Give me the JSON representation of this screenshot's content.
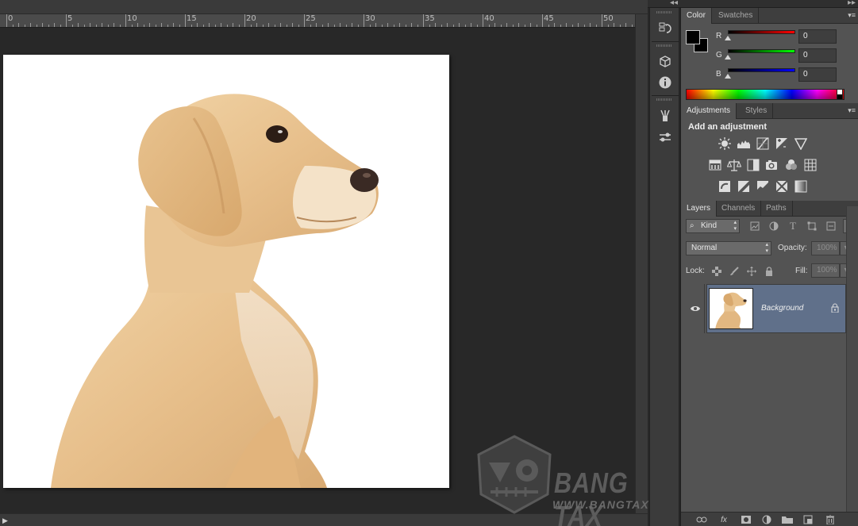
{
  "ruler": {
    "labels": [
      "0",
      "5",
      "10",
      "15",
      "20",
      "25",
      "30",
      "35",
      "40",
      "45",
      "50"
    ]
  },
  "watermark": {
    "brand": "BANG TAX",
    "url": "WWW.BANGTAX.NET"
  },
  "toolstrip": {
    "icons": [
      "history-icon",
      "3d-cube-icon",
      "info-icon",
      "brush-presets-icon",
      "tool-presets-icon"
    ]
  },
  "color_panel": {
    "tabs": [
      "Color",
      "Swatches"
    ],
    "active_tab": "Color",
    "foreground": "#000000",
    "background": "#000000",
    "channels": [
      {
        "label": "R",
        "value": "0",
        "color": "#ff0000"
      },
      {
        "label": "G",
        "value": "0",
        "color": "#00ff00"
      },
      {
        "label": "B",
        "value": "0",
        "color": "#0000ff"
      }
    ]
  },
  "adjustments_panel": {
    "tabs": [
      "Adjustments",
      "Styles"
    ],
    "active_tab": "Adjustments",
    "title": "Add an adjustment",
    "icons": [
      [
        "brightness-contrast-icon",
        "levels-icon",
        "curves-icon",
        "exposure-icon",
        "vibrance-icon"
      ],
      [
        "hue-saturation-icon",
        "color-balance-icon",
        "black-white-icon",
        "photo-filter-icon",
        "channel-mixer-icon",
        "color-lookup-icon"
      ],
      [
        "invert-icon",
        "posterize-icon",
        "threshold-icon",
        "selective-color-icon",
        "gradient-map-icon"
      ]
    ]
  },
  "layers_panel": {
    "tabs": [
      "Layers",
      "Channels",
      "Paths"
    ],
    "active_tab": "Layers",
    "filter": {
      "value": "Kind"
    },
    "blend_mode": "Normal",
    "opacity": {
      "label": "Opacity:",
      "value": "100%"
    },
    "lock": {
      "label": "Lock:"
    },
    "fill": {
      "label": "Fill:",
      "value": "100%"
    },
    "layers": [
      {
        "name": "Background",
        "visible": true,
        "locked": true
      }
    ],
    "footer_icons": [
      "link-layers-icon",
      "fx-icon",
      "add-mask-icon",
      "new-adjustment-icon",
      "new-group-icon",
      "new-layer-icon",
      "delete-layer-icon"
    ],
    "fx_label": "fx"
  }
}
